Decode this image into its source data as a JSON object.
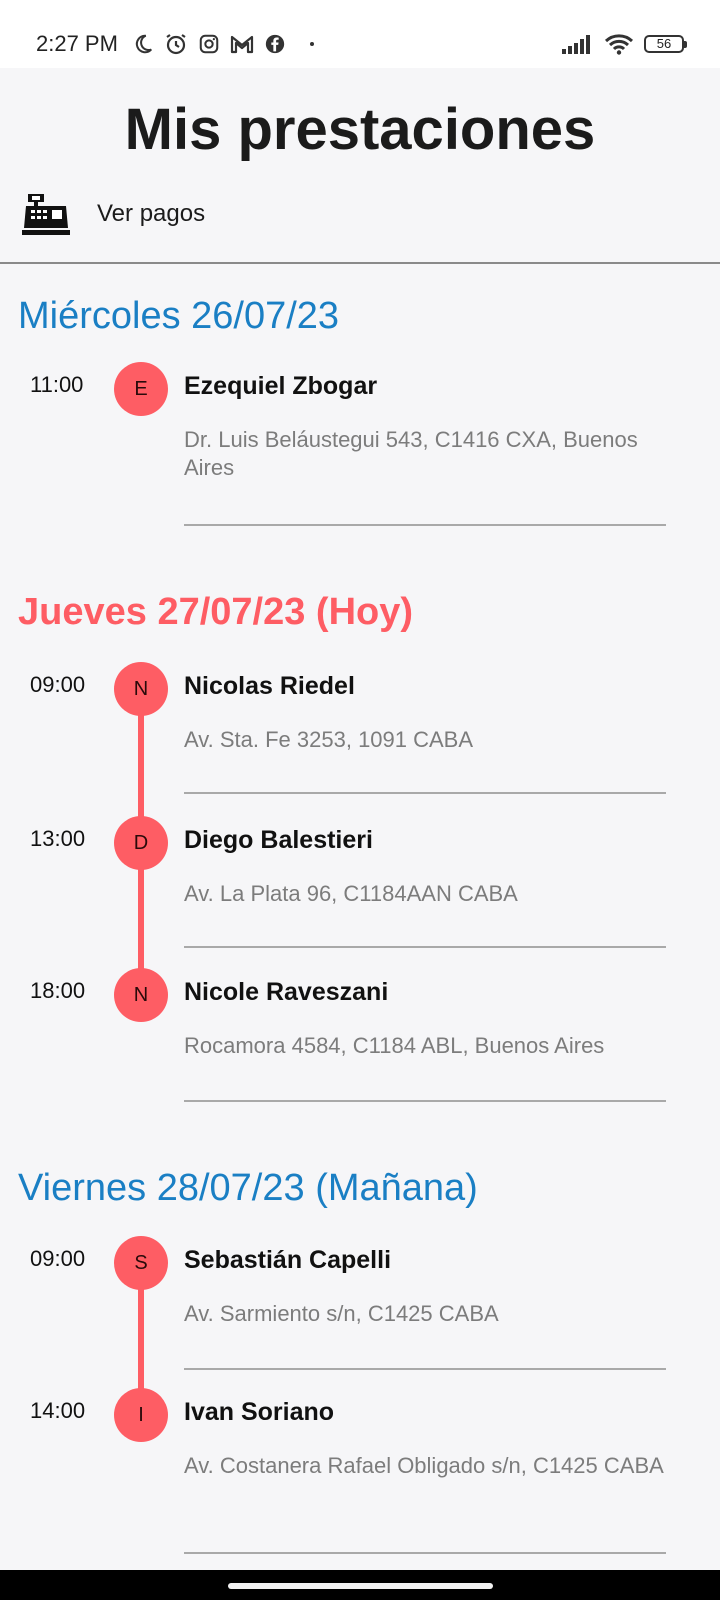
{
  "status_bar": {
    "time": "2:27 PM",
    "battery": "56",
    "left_icons": [
      "moon-icon",
      "alarm-icon",
      "instagram-icon",
      "gmail-icon",
      "facebook-icon"
    ],
    "right_icons": [
      "signal-icon",
      "wifi-icon",
      "battery-icon"
    ]
  },
  "header": {
    "title": "Mis prestaciones",
    "payments_label": "Ver pagos",
    "payments_icon": "cash-register-icon"
  },
  "colors": {
    "accent_red": "#fe5d64",
    "day_blue": "#1a7fc4",
    "address_gray": "#7c7c7c"
  },
  "days": [
    {
      "label": "Miércoles 26/07/23",
      "slots": [
        {
          "time": "11:00",
          "initial": "E",
          "name": "Ezequiel Zbogar",
          "address": "Dr. Luis Beláustegui 543, C1416 CXA, Buenos Aires"
        }
      ]
    },
    {
      "label": "Jueves 27/07/23 (Hoy)",
      "slots": [
        {
          "time": "09:00",
          "initial": "N",
          "name": "Nicolas Riedel",
          "address": "Av. Sta. Fe 3253, 1091 CABA"
        },
        {
          "time": "13:00",
          "initial": "D",
          "name": "Diego Balestieri",
          "address": "Av. La Plata 96, C1184AAN CABA"
        },
        {
          "time": "18:00",
          "initial": "N",
          "name": "Nicole Raveszani",
          "address": "Rocamora 4584, C1184 ABL, Buenos Aires"
        }
      ]
    },
    {
      "label": "Viernes 28/07/23 (Mañana)",
      "slots": [
        {
          "time": "09:00",
          "initial": "S",
          "name": "Sebastián Capelli",
          "address": "Av. Sarmiento s/n, C1425 CABA"
        },
        {
          "time": "14:00",
          "initial": "I",
          "name": "Ivan Soriano",
          "address": "Av. Costanera Rafael Obligado s/n, C1425 CABA"
        }
      ]
    }
  ]
}
